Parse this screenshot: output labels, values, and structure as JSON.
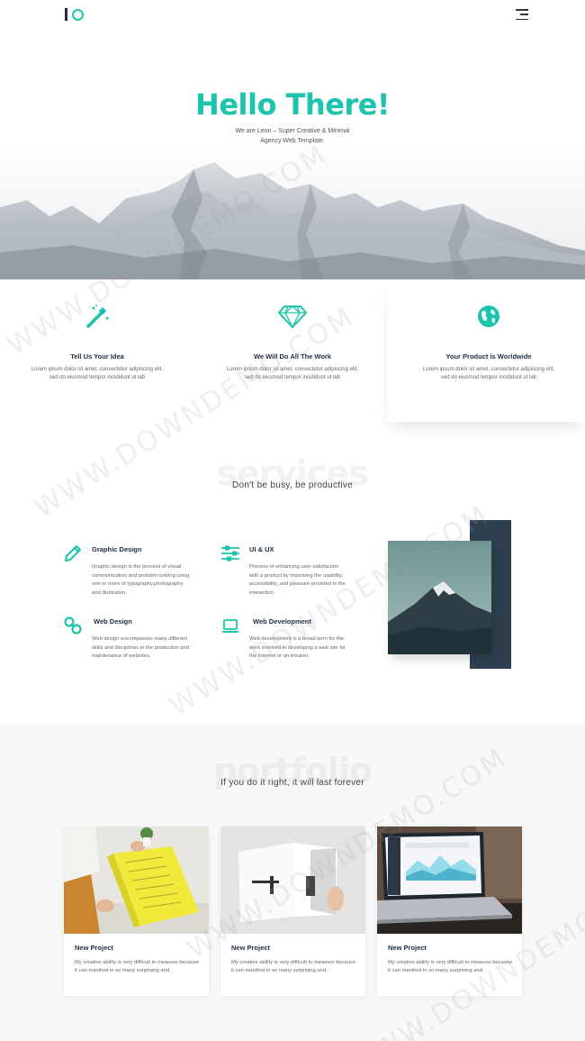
{
  "header": {
    "logo_icon": "logo-mark-icon",
    "menu_icon": "hamburger-icon"
  },
  "hero": {
    "title": "Hello There!",
    "subtitle": "We are Leon – Super Creative & Minimal Agency Web Template."
  },
  "features": [
    {
      "icon": "magic-wand-icon",
      "title": "Tell Us Your Idea",
      "text": "Lorem ipsum dolor sit amet, consectetur adipiscing elit, sed do eiusmod tempor incididunt ut lab"
    },
    {
      "icon": "diamond-icon",
      "title": "We Will Do All The Work",
      "text": "Lorem ipsum dolor sit amet, consectetur adipiscing elit, sed do eiusmod tempor incididunt ut lab"
    },
    {
      "icon": "globe-icon",
      "title": "Your Product is Worldwide",
      "text": "Lorem ipsum dolor sit amet, consectetur adipiscing elit, sed do eiusmod tempor incididunt ut lab"
    }
  ],
  "services": {
    "bg_word": "services",
    "tagline": "Don't be busy, be productive",
    "items": [
      {
        "icon": "pencil-icon",
        "title": "Graphic Design",
        "text": "Graphic design is the process of visual communication and problem-solving using one or more of typography,photography and illustration."
      },
      {
        "icon": "sliders-icon",
        "title": "UI & UX",
        "text": "Process of enhancing user satisfaction with a product by improving the usability, accessibility, and pleasure provided in the interaction."
      },
      {
        "icon": "link-icon",
        "title": "Web Design",
        "text": "Web design encompasses many different skills and disciplines in the production and maintenance of websites."
      },
      {
        "icon": "laptop-icon",
        "title": "Web Development",
        "text": "Web development is a broad term for the work involved in developing a web site for the Internet or an intranet."
      }
    ]
  },
  "portfolio": {
    "bg_word": "portfolio",
    "tagline": "If you do it right, it will last forever",
    "cards": [
      {
        "title": "New Project",
        "text": "My creative ability is very difficult to measure because it can manifest in so many surprising and."
      },
      {
        "title": "New Project",
        "text": "My creative ability is very difficult to measure because it can manifest in so many surprising and."
      },
      {
        "title": "New Project",
        "text": "My creative ability is very difficult to measure because it can manifest in so many surprising and."
      }
    ]
  },
  "watermark": "WWW.DOWNDEMO.COM",
  "colors": {
    "accent": "#1cc4ab",
    "dark": "#1f2d3d",
    "panel": "#2e4050"
  }
}
